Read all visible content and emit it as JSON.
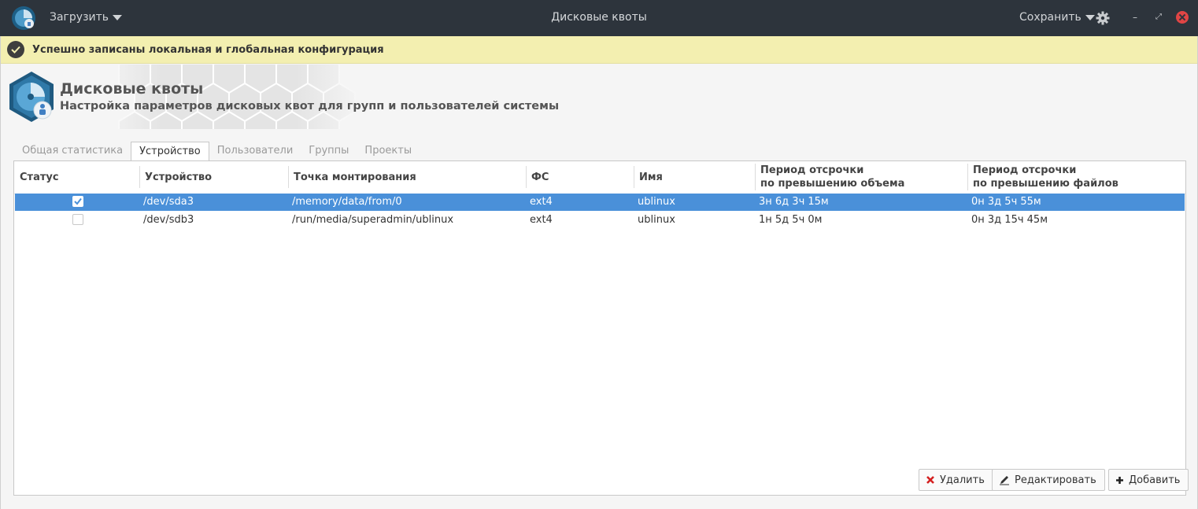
{
  "titlebar": {
    "load_label": "Загрузить",
    "title": "Дисковые квоты",
    "save_label": "Сохранить",
    "minimize": "–",
    "maximize": "⤢"
  },
  "infobar": {
    "message": "Успешно записаны локальная и глобальная конфигурация"
  },
  "header": {
    "title": "Дисковые квоты",
    "subtitle": "Настройка параметров дисковых квот для групп и пользователей системы"
  },
  "tabs": [
    {
      "label": "Общая статистика",
      "active": false
    },
    {
      "label": "Устройство",
      "active": true
    },
    {
      "label": "Пользователи",
      "active": false
    },
    {
      "label": "Группы",
      "active": false
    },
    {
      "label": "Проекты",
      "active": false
    }
  ],
  "table": {
    "columns": {
      "status": "Статус",
      "device": "Устройство",
      "mount": "Точка монтирования",
      "fs": "ФС",
      "name": "Имя",
      "grace_space_1": "Период отсрочки",
      "grace_space_2": "по превышению объема",
      "grace_files_1": "Период отсрочки",
      "grace_files_2": "по превышению файлов"
    },
    "rows": [
      {
        "enabled": true,
        "device": "/dev/sda3",
        "mount": "/memory/data/from/0",
        "fs": "ext4",
        "name": "ublinux",
        "grace_space": "3н 6д 3ч 15м",
        "grace_files": "0н 3д 5ч 55м",
        "selected": true
      },
      {
        "enabled": false,
        "device": "/dev/sdb3",
        "mount": "/run/media/superadmin/ublinux",
        "fs": "ext4",
        "name": "ublinux",
        "grace_space": "1н 5д 5ч 0м",
        "grace_files": "0н 3д 15ч 45м",
        "selected": false
      }
    ]
  },
  "buttons": {
    "delete": "Удалить",
    "edit": "Редактировать",
    "add": "Добавить"
  },
  "colors": {
    "titlebar_bg": "#2d343c",
    "infobar_bg": "#f3efb0",
    "selection": "#4a90d9",
    "close": "#e04545"
  }
}
